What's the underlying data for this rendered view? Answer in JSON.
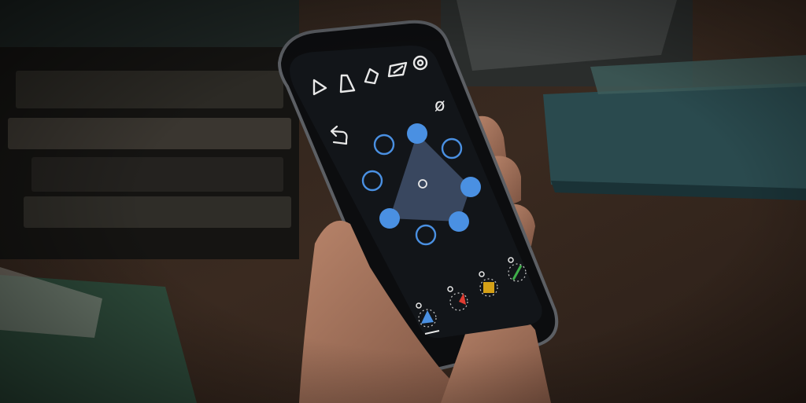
{
  "toolbar": {
    "icons": [
      "triangle-icon",
      "trapezoid-icon",
      "diamond-icon",
      "parallelogram-icon",
      "settings-gear-icon"
    ],
    "null_symbol": "ø",
    "undo_icon": "undo-arrow-icon"
  },
  "polygon_editor": {
    "accent": "#4a90e2",
    "nodes_total": 8,
    "active_nodes": [
      0,
      2,
      4,
      5
    ],
    "center_indicator": "o"
  },
  "instruments": [
    {
      "name": "blue-triangle",
      "color": "#4a90e2",
      "selected": true
    },
    {
      "name": "red-wedge",
      "color": "#e03c31",
      "selected": false
    },
    {
      "name": "yellow-square",
      "color": "#d4a017",
      "selected": false
    },
    {
      "name": "green-line",
      "color": "#3fb04a",
      "selected": false
    }
  ],
  "colors": {
    "screen": "#111418",
    "node_stroke": "#4a90e2",
    "polygon_fill": "#3c4a63"
  }
}
